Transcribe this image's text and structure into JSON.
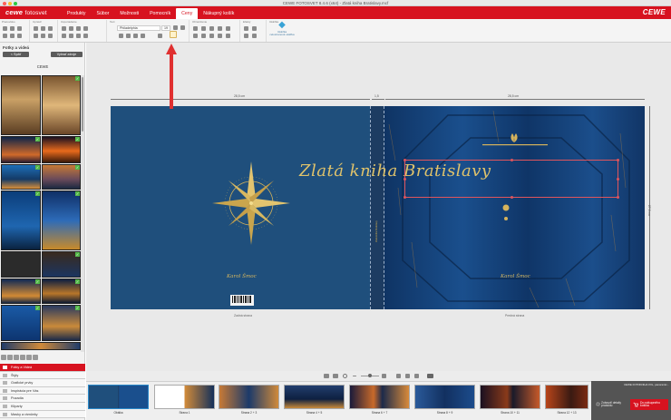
{
  "window": {
    "title": "CEWE FOTOSVET 8.4.6 (x64) - Zlatá kniha Bratislavy.mcf"
  },
  "app": {
    "logo": "cewe",
    "logo_sub": "fotosvet",
    "brand_right": "CEWE"
  },
  "menu": {
    "items": [
      {
        "label": "Produkty",
        "active": false
      },
      {
        "label": "Súbor",
        "active": false
      },
      {
        "label": "Možnosti",
        "active": false
      },
      {
        "label": "Pomocník",
        "active": false
      },
      {
        "label": "Ceny",
        "active": true
      },
      {
        "label": "Nákupný košík",
        "active": false
      }
    ]
  },
  "ribbon": {
    "groups": [
      "Pracovisko",
      "Upraviť",
      "Usporiadanie",
      "Text",
      "Ohraničenie",
      "Efekty",
      "Ukážka"
    ],
    "font_name": "Philadelphia",
    "font_size": "19",
    "preview_button": {
      "label": "Ukážka",
      "sub": "celostranová ukážka"
    },
    "accent": "#d7121f"
  },
  "sidebar": {
    "title": "Fotky a videá",
    "back_label": "< Späť",
    "select_label": "Vybrať zdroje",
    "folder_label": "CEWE",
    "accordion": [
      {
        "label": "Fotky a Videá",
        "active": true
      },
      {
        "label": "Štýly",
        "active": false
      },
      {
        "label": "Grafické prvky",
        "active": false
      },
      {
        "label": "Inspirácia pre Vás",
        "active": false
      },
      {
        "label": "Pozadia",
        "active": false
      },
      {
        "label": "Kliparty",
        "active": false
      },
      {
        "label": "Masky a rámčeky",
        "active": false
      }
    ]
  },
  "canvas": {
    "dim_back": "28,5 cm",
    "dim_spine": "1,5",
    "dim_front": "28,5 cm",
    "dim_height": "27,5 cm",
    "back_label": "Zadná strana",
    "front_label": "Predná strana",
    "author": "Karol Šmoc",
    "cover_title": "Zlatá kniha Bratislavy",
    "spine_text": "Zlatá kniha Bratislavy"
  },
  "filmstrip": {
    "items": [
      "Obálka",
      "Strana 1",
      "Strana 2 + 3",
      "Strana 4 + 5",
      "Strana 6 + 7",
      "Strana 8 + 9",
      "Strana 10 + 11",
      "Strana 12 + 13"
    ]
  },
  "cart_panel": {
    "note": "CEWE FOTOKNIHA XXL, panoramic...",
    "details_label": "Zobraziť detaily produktu",
    "cart_label": "Do nákupného košíka"
  }
}
